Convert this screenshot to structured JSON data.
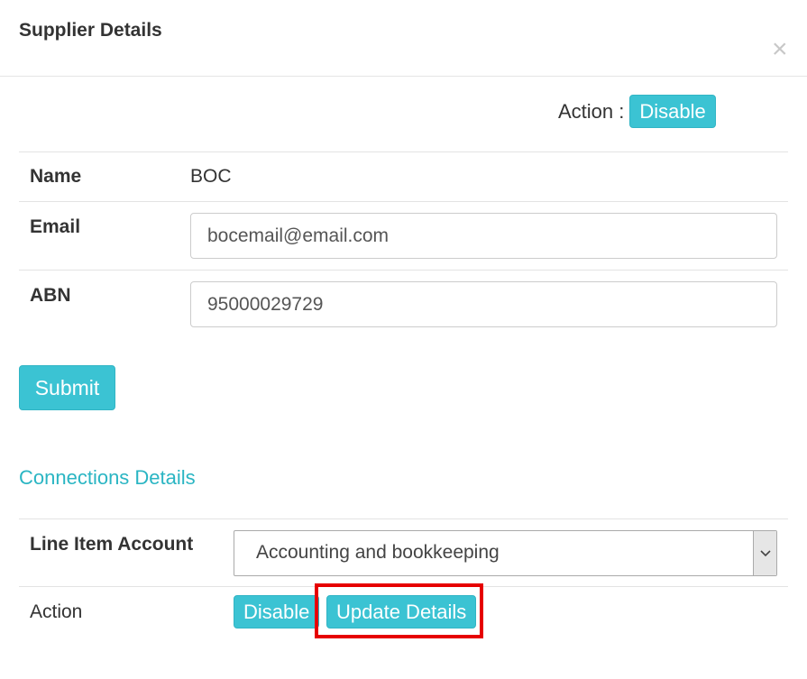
{
  "modal": {
    "title": "Supplier Details",
    "close_glyph": "×"
  },
  "top_action": {
    "label": "Action :",
    "disable_label": "Disable"
  },
  "details": {
    "name_label": "Name",
    "name_value": "BOC",
    "email_label": "Email",
    "email_value": "bocemail@email.com",
    "abn_label": "ABN",
    "abn_value": "95000029729",
    "submit_label": "Submit"
  },
  "connections": {
    "title": "Connections Details",
    "line_item_label": "Line Item Account",
    "line_item_value": "Accounting and bookkeeping",
    "action_label": "Action",
    "disable_label": "Disable",
    "update_label": "Update Details"
  },
  "colors": {
    "accent": "#3bc3d3",
    "section_title": "#2ab5c3",
    "highlight": "#e60000"
  },
  "icons": {
    "close": "close-icon",
    "select_arrow": "chevron-down-icon"
  }
}
